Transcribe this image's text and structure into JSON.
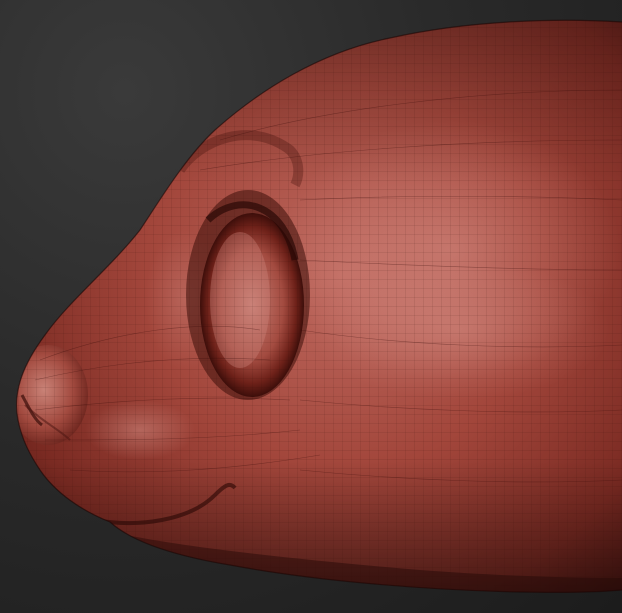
{
  "scene": {
    "subject": "3d-sculpt-animal-head",
    "material_color": "#9a3e34",
    "highlight_color": "#d88f86",
    "shadow_color": "#4a1511",
    "background_color": "#2b2b2b",
    "wireframe": true
  }
}
